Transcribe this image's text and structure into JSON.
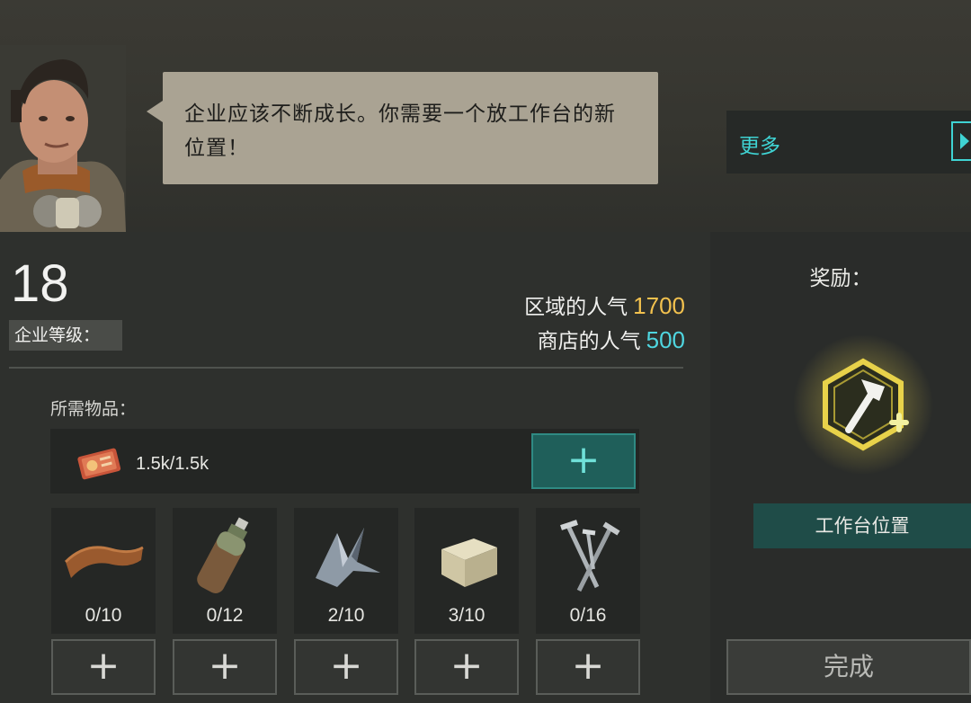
{
  "dialog": {
    "text": "企业应该不断成长。你需要一个放工作台的新位置！"
  },
  "more_button": {
    "label": "更多",
    "icon": "play-arrow-icon"
  },
  "enterprise": {
    "level_value": "18",
    "level_label": "企业等级："
  },
  "popularity": {
    "area_label": "区域的人气",
    "area_value": "1700",
    "area_color": "#f2c14e",
    "store_label": "商店的人气",
    "store_value": "500",
    "store_color": "#4fd6e0"
  },
  "requirements": {
    "label": "所需物品：",
    "money": {
      "value": "1.5k/1.5k",
      "icon": "ticket-icon",
      "add_label": "+"
    },
    "items": [
      {
        "icon": "leather-icon",
        "count": "0/10",
        "add_label": "+"
      },
      {
        "icon": "bottle-icon",
        "count": "0/12",
        "add_label": "+"
      },
      {
        "icon": "scrap-metal-icon",
        "count": "2/10",
        "add_label": "+"
      },
      {
        "icon": "stone-block-icon",
        "count": "3/10",
        "add_label": "+"
      },
      {
        "icon": "nails-icon",
        "count": "0/16",
        "add_label": "+"
      }
    ]
  },
  "reward": {
    "label": "奖励：",
    "icon": "hammer-plus-icon",
    "name": "工作台位置"
  },
  "complete_button": {
    "label": "完成"
  },
  "colors": {
    "accent_teal": "#3fd3d3",
    "reward_gold": "#e8d24a",
    "add_button_teal": "#1f5f5a"
  }
}
